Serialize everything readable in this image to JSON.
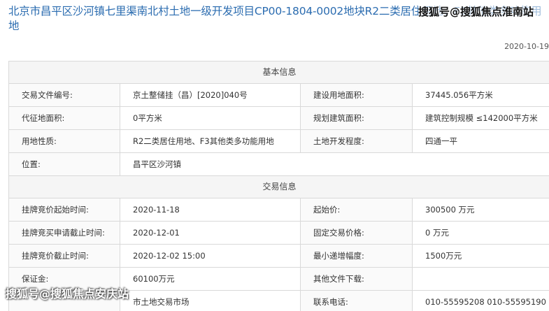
{
  "title": "北京市昌平区沙河镇七里渠南北村土地一级开发项目CP00-1804-0002地块R2二类居住用地、F3其他类多功能用地",
  "date": "2020-10-19",
  "watermark_top": "搜狐号@搜狐焦点淮南站",
  "watermark_bottom": "搜狐号@搜狐焦点安庆站",
  "sections": {
    "basic": "基本信息",
    "trade": "交易信息"
  },
  "basic_rows": [
    {
      "l1": "交易文件编号:",
      "v1": "京土整储挂（昌）[2020]040号",
      "l2": "建设用地面积:",
      "v2": "37445.056平方米"
    },
    {
      "l1": "代征地面积:",
      "v1": "0平方米",
      "l2": "规划建筑面积:",
      "v2": "建筑控制规模 ≤142000平方米"
    },
    {
      "l1": "用地性质:",
      "v1": "R2二类居住用地、F3其他类多功能用地",
      "l2": "土地开发程度:",
      "v2": "四通一平"
    }
  ],
  "location": {
    "label": "位置:",
    "value": "昌平区沙河镇"
  },
  "trade_rows": [
    {
      "l1": "挂牌竞价起始时间:",
      "v1": "2020-11-18",
      "l2": "起始价:",
      "v2": "300500 万元"
    },
    {
      "l1": "挂牌竞买申请截止时间:",
      "v1": "2020-12-01",
      "l2": "固定交易价格:",
      "v2": "0 万元"
    },
    {
      "l1": "挂牌竞价截止时间:",
      "v1": "2020-12-02 15:00",
      "l2": "最小递增幅度:",
      "v2": "1500万元"
    },
    {
      "l1": "保证金:",
      "v1": "60100万元",
      "l2": "其他文件下载:",
      "v2": ""
    },
    {
      "l1": "",
      "v1": "市土地交易市场",
      "l2": "联系电话:",
      "v2": "010-55595208 010-55595190"
    }
  ]
}
